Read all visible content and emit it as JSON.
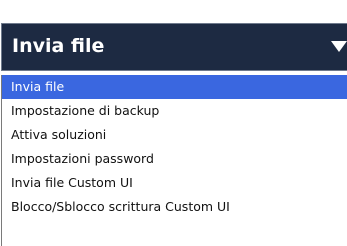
{
  "select": {
    "selected_label": "Invia file",
    "caret_icon": "triangle-down-icon",
    "options": [
      {
        "label": "Invia file",
        "selected": true
      },
      {
        "label": "Impostazione di backup",
        "selected": false
      },
      {
        "label": "Attiva soluzioni",
        "selected": false
      },
      {
        "label": "Impostazioni password",
        "selected": false
      },
      {
        "label": "Invia file Custom UI",
        "selected": false
      },
      {
        "label": "Blocco/Sblocco scrittura Custom UI",
        "selected": false
      }
    ]
  },
  "colors": {
    "header_background": "#1d2a42",
    "selected_background": "#3a67e0",
    "selected_text": "#ffffff",
    "option_text": "#111111"
  }
}
